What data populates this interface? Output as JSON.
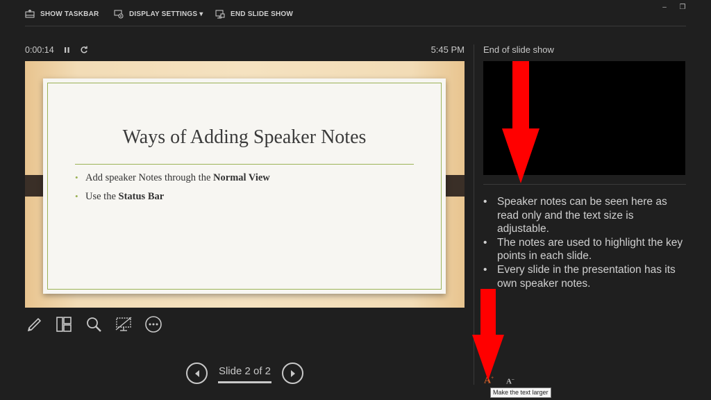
{
  "toolbar": {
    "show_taskbar": "SHOW TASKBAR",
    "display_settings": "DISPLAY SETTINGS",
    "display_settings_caret": "▾",
    "end_slide_show": "END SLIDE SHOW"
  },
  "window_controls": {
    "minimize": "–",
    "restore": "❐"
  },
  "presenter": {
    "elapsed_time": "0:00:14",
    "clock": "5:45 PM",
    "next_label": "End of slide show"
  },
  "slide": {
    "title": "Ways of Adding Speaker Notes",
    "bullet_marker": "•",
    "bullets": [
      {
        "text": "Add speaker Notes through the ",
        "bold": "Normal View"
      },
      {
        "text": "Use the ",
        "bold": "Status Bar"
      }
    ]
  },
  "navigation": {
    "slide_counter": "Slide 2 of 2"
  },
  "notes": {
    "bullet_marker": "•",
    "items": [
      "Speaker notes can be seen here as read only and the text size is adjustable.",
      "The notes are used to highlight the key points in each slide.",
      "Every slide in the presentation has its own speaker notes."
    ]
  },
  "font_controls": {
    "larger_glyph": "A",
    "larger_sup": "+",
    "smaller_glyph": "A",
    "smaller_sup": "–",
    "tooltip": "Make the text larger"
  },
  "colors": {
    "annotation_arrow": "#ff0000",
    "active_font_control": "#d9622b",
    "slide_accent": "#9bb256"
  },
  "icons": [
    "show-taskbar-icon",
    "display-settings-icon",
    "end-slide-show-icon",
    "pause-icon",
    "restart-icon",
    "pen-icon",
    "see-all-slides-icon",
    "zoom-icon",
    "black-screen-icon",
    "more-options-icon",
    "previous-arrow-icon",
    "next-arrow-icon"
  ]
}
